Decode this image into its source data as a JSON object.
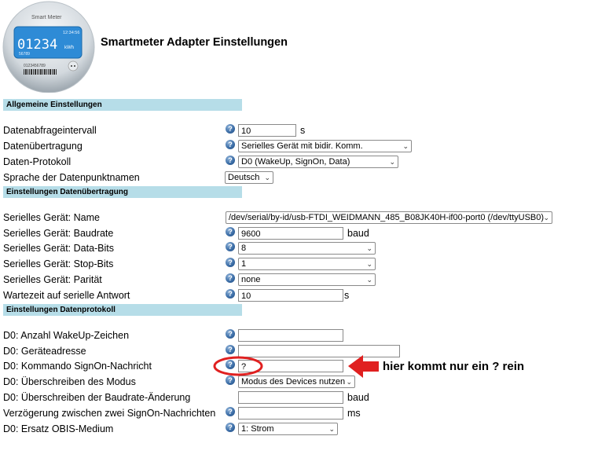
{
  "meter": {
    "brand": "Smart Meter",
    "time": "12:34:56",
    "reading": "01234",
    "unit": "kWh",
    "small": "56789",
    "serial": "0123456789"
  },
  "page_title": "Smartmeter Adapter Einstellungen",
  "sections": {
    "general": "Allgemeine Einstellungen",
    "transfer": "Einstellungen Datenübertragung",
    "protocol": "Einstellungen Datenprotokoll"
  },
  "help_glyph": "?",
  "general": {
    "interval": {
      "label": "Datenabfrageintervall",
      "value": "10",
      "unit": "s"
    },
    "transfer": {
      "label": "Datenübertragung",
      "value": "Serielles Gerät mit bidir. Komm."
    },
    "protocol": {
      "label": "Daten-Protokoll",
      "value": "D0 (WakeUp, SignOn, Data)"
    },
    "language": {
      "label": "Sprache der Datenpunktnamen",
      "value": "Deutsch"
    }
  },
  "serial": {
    "device": {
      "label": "Serielles Gerät: Name",
      "value": "/dev/serial/by-id/usb-FTDI_WEIDMANN_485_B08JK40H-if00-port0 (/dev/ttyUSB0)"
    },
    "baudrate": {
      "label": "Serielles Gerät: Baudrate",
      "value": "9600",
      "unit": "baud"
    },
    "databits": {
      "label": "Serielles Gerät: Data-Bits",
      "value": "8"
    },
    "stopbits": {
      "label": "Serielles Gerät: Stop-Bits",
      "value": "1"
    },
    "parity": {
      "label": "Serielles Gerät: Parität",
      "value": "none"
    },
    "timeout": {
      "label": "Wartezeit auf serielle Antwort",
      "value": "10",
      "unit": "s"
    }
  },
  "d0": {
    "wakeup": {
      "label": "D0: Anzahl WakeUp-Zeichen",
      "value": ""
    },
    "address": {
      "label": "D0: Geräteadresse",
      "value": ""
    },
    "signon": {
      "label": "D0: Kommando SignOn-Nachricht",
      "value": "?"
    },
    "mode": {
      "label": "D0: Überschreiben des Modus",
      "value": "Modus des Devices nutzen"
    },
    "baud_override": {
      "label": "D0: Überschreiben der Baudrate-Änderung",
      "value": "",
      "unit": "baud"
    },
    "delay": {
      "label": "Verzögerung zwischen zwei SignOn-Nachrichten",
      "value": "",
      "unit": "ms"
    },
    "obis": {
      "label": "D0: Ersatz OBIS-Medium",
      "value": "1: Strom"
    }
  },
  "annotation": {
    "text": "hier kommt nur ein ? rein",
    "color": "#e02020"
  }
}
